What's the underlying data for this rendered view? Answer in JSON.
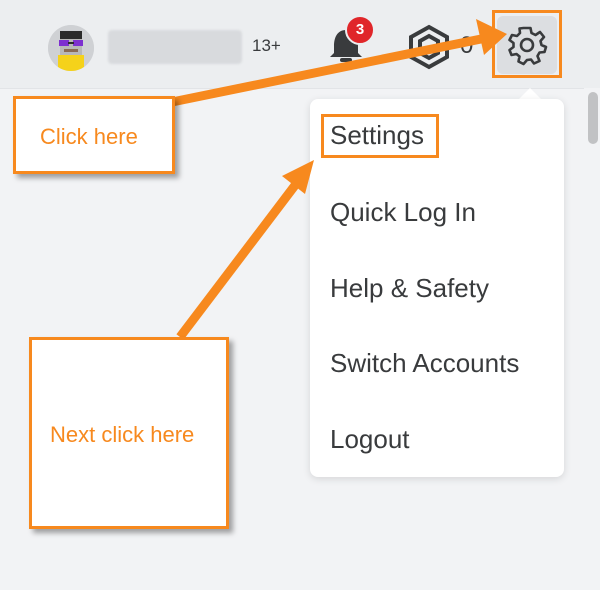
{
  "header": {
    "age_badge": "13+",
    "notification_count": "3",
    "robux_amount": "0"
  },
  "dropdown": {
    "items": [
      {
        "label": "Settings"
      },
      {
        "label": "Quick Log In"
      },
      {
        "label": "Help & Safety"
      },
      {
        "label": "Switch Accounts"
      },
      {
        "label": "Logout"
      }
    ]
  },
  "annotations": {
    "first": "Click here",
    "second": "Next click here"
  },
  "colors": {
    "accent": "#f7891e",
    "badge": "#e0262a",
    "text": "#393b3d"
  },
  "icons": [
    "avatar",
    "notification-bell-icon",
    "robux-icon",
    "gear-icon"
  ]
}
